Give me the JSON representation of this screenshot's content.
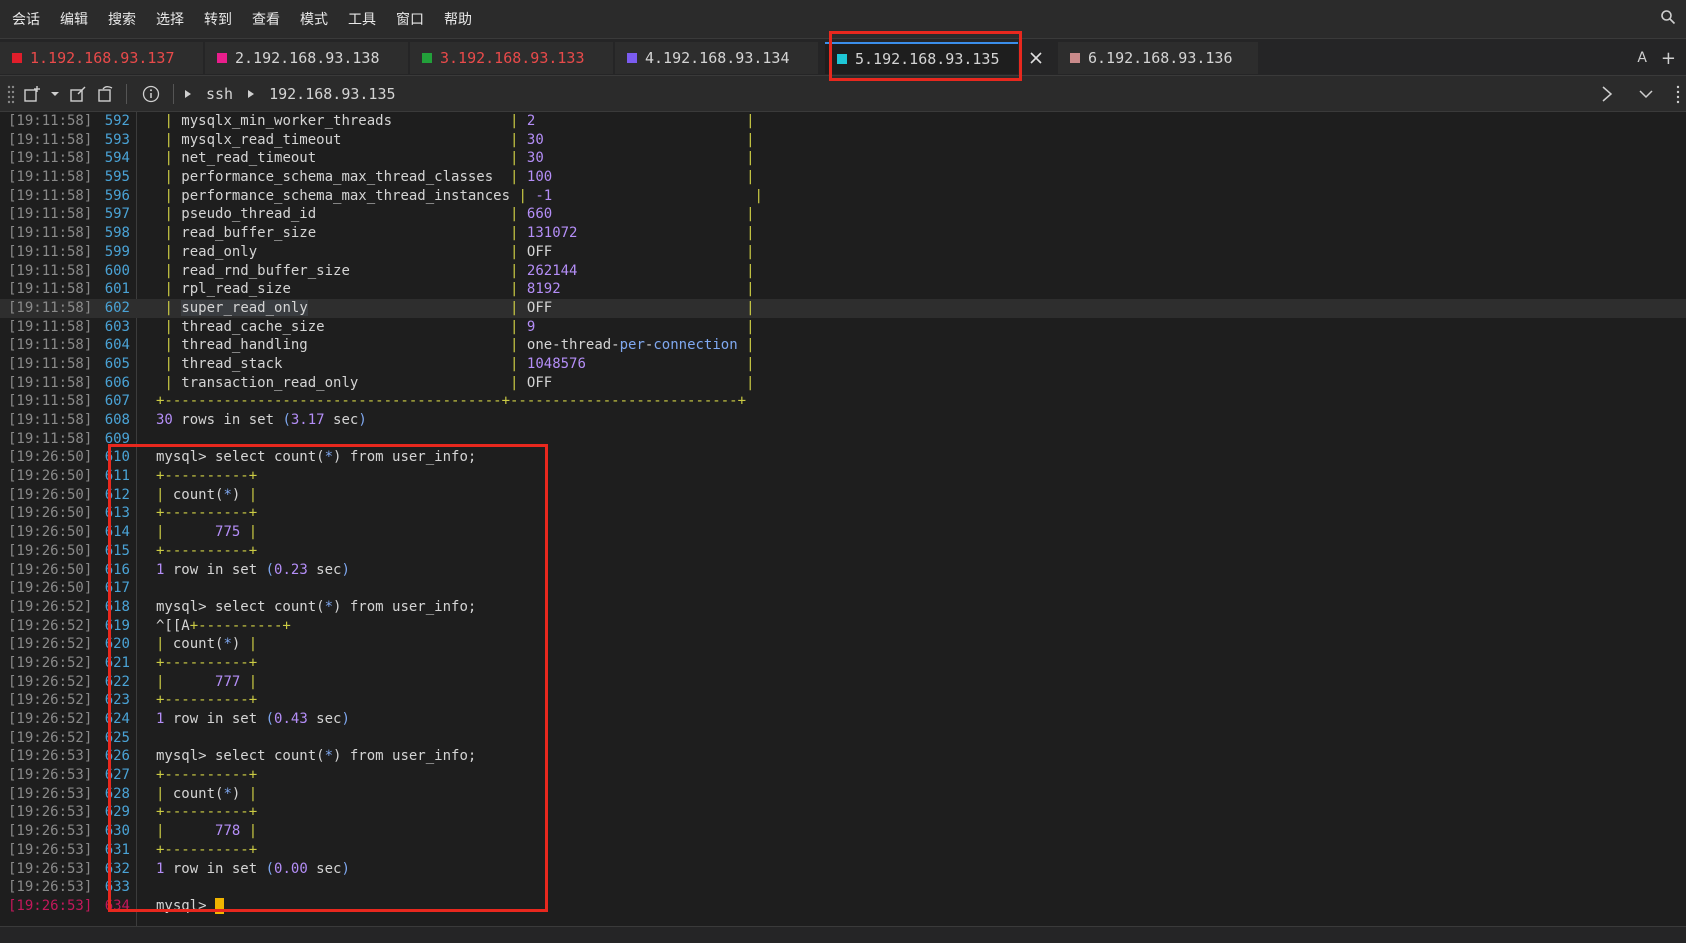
{
  "menu": [
    "会话",
    "编辑",
    "搜索",
    "选择",
    "转到",
    "查看",
    "模式",
    "工具",
    "窗口",
    "帮助"
  ],
  "tabs": [
    {
      "label": "1.192.168.93.137",
      "color": "#e01e2b",
      "text_color": "#e84a4a"
    },
    {
      "label": "2.192.168.93.138",
      "color": "#e91e8c",
      "text_color": "#d4d4d4"
    },
    {
      "label": "3.192.168.93.133",
      "color": "#22a03a",
      "text_color": "#e84a4a"
    },
    {
      "label": "4.192.168.93.134",
      "color": "#7b5cf0",
      "text_color": "#d4d4d4"
    },
    {
      "label": "5.192.168.93.135",
      "color": "#1ec7d6",
      "text_color": "#d4d4d4"
    },
    {
      "label": "6.192.168.93.136",
      "color": "#c98a8a",
      "text_color": "#d4d4d4"
    }
  ],
  "tabbar_right": {
    "font_label": "A",
    "add_label": "+"
  },
  "toolbar": {
    "protocol": "ssh",
    "host": "192.168.93.135"
  },
  "lines": [
    {
      "ts": "[19:11:58]",
      "ln": "592",
      "text": " | mysqlx_min_worker_threads              | 2                         |"
    },
    {
      "ts": "[19:11:58]",
      "ln": "593",
      "text": " | mysqlx_read_timeout                    | 30                        |"
    },
    {
      "ts": "[19:11:58]",
      "ln": "594",
      "text": " | net_read_timeout                       | 30                        |"
    },
    {
      "ts": "[19:11:58]",
      "ln": "595",
      "text": " | performance_schema_max_thread_classes  | 100                       |"
    },
    {
      "ts": "[19:11:58]",
      "ln": "596",
      "text": " | performance_schema_max_thread_instances | -1                        |"
    },
    {
      "ts": "[19:11:58]",
      "ln": "597",
      "text": " | pseudo_thread_id                       | 660                       |"
    },
    {
      "ts": "[19:11:58]",
      "ln": "598",
      "text": " | read_buffer_size                       | 131072                    |"
    },
    {
      "ts": "[19:11:58]",
      "ln": "599",
      "text": " | read_only                              | OFF                       |"
    },
    {
      "ts": "[19:11:58]",
      "ln": "600",
      "text": " | read_rnd_buffer_size                   | 262144                    |"
    },
    {
      "ts": "[19:11:58]",
      "ln": "601",
      "text": " | rpl_read_size                          | 8192                      |"
    },
    {
      "ts": "[19:11:58]",
      "ln": "602",
      "text": " | super_read_only                        | OFF                       |"
    },
    {
      "ts": "[19:11:58]",
      "ln": "603",
      "text": " | thread_cache_size                      | 9                         |"
    },
    {
      "ts": "[19:11:58]",
      "ln": "604",
      "text": " | thread_handling                        | one-thread-per-connection |"
    },
    {
      "ts": "[19:11:58]",
      "ln": "605",
      "text": " | thread_stack                           | 1048576                   |"
    },
    {
      "ts": "[19:11:58]",
      "ln": "606",
      "text": " | transaction_read_only                  | OFF                       |"
    },
    {
      "ts": "[19:11:58]",
      "ln": "607",
      "text": "+----------------------------------------+---------------------------+"
    },
    {
      "ts": "[19:11:58]",
      "ln": "608",
      "text": "30 rows in set (3.17 sec)"
    },
    {
      "ts": "[19:11:58]",
      "ln": "609",
      "text": ""
    },
    {
      "ts": "[19:26:50]",
      "ln": "610",
      "text": "mysql> select count(*) from user_info;"
    },
    {
      "ts": "[19:26:50]",
      "ln": "611",
      "text": "+----------+"
    },
    {
      "ts": "[19:26:50]",
      "ln": "612",
      "text": "| count(*) |"
    },
    {
      "ts": "[19:26:50]",
      "ln": "613",
      "text": "+----------+"
    },
    {
      "ts": "[19:26:50]",
      "ln": "614",
      "text": "|      775 |"
    },
    {
      "ts": "[19:26:50]",
      "ln": "615",
      "text": "+----------+"
    },
    {
      "ts": "[19:26:50]",
      "ln": "616",
      "text": "1 row in set (0.23 sec)"
    },
    {
      "ts": "[19:26:50]",
      "ln": "617",
      "text": ""
    },
    {
      "ts": "[19:26:52]",
      "ln": "618",
      "text": "mysql> select count(*) from user_info;"
    },
    {
      "ts": "[19:26:52]",
      "ln": "619",
      "text": "^[[A+----------+"
    },
    {
      "ts": "[19:26:52]",
      "ln": "620",
      "text": "| count(*) |"
    },
    {
      "ts": "[19:26:52]",
      "ln": "621",
      "text": "+----------+"
    },
    {
      "ts": "[19:26:52]",
      "ln": "622",
      "text": "|      777 |"
    },
    {
      "ts": "[19:26:52]",
      "ln": "623",
      "text": "+----------+"
    },
    {
      "ts": "[19:26:52]",
      "ln": "624",
      "text": "1 row in set (0.43 sec)"
    },
    {
      "ts": "[19:26:52]",
      "ln": "625",
      "text": ""
    },
    {
      "ts": "[19:26:53]",
      "ln": "626",
      "text": "mysql> select count(*) from user_info;"
    },
    {
      "ts": "[19:26:53]",
      "ln": "627",
      "text": "+----------+"
    },
    {
      "ts": "[19:26:53]",
      "ln": "628",
      "text": "| count(*) |"
    },
    {
      "ts": "[19:26:53]",
      "ln": "629",
      "text": "+----------+"
    },
    {
      "ts": "[19:26:53]",
      "ln": "630",
      "text": "|      778 |"
    },
    {
      "ts": "[19:26:53]",
      "ln": "631",
      "text": "+----------+"
    },
    {
      "ts": "[19:26:53]",
      "ln": "632",
      "text": "1 row in set (0.00 sec)"
    },
    {
      "ts": "[19:26:53]",
      "ln": "633",
      "text": ""
    },
    {
      "ts": "[19:26:53]",
      "ln": "634",
      "text": "mysql> "
    }
  ],
  "highlight": {
    "row": 10,
    "selected_text": "super_read_only"
  },
  "colors": {
    "accent": "#3b8eea",
    "annotation": "#e8281e",
    "cursor": "#f0b400"
  }
}
